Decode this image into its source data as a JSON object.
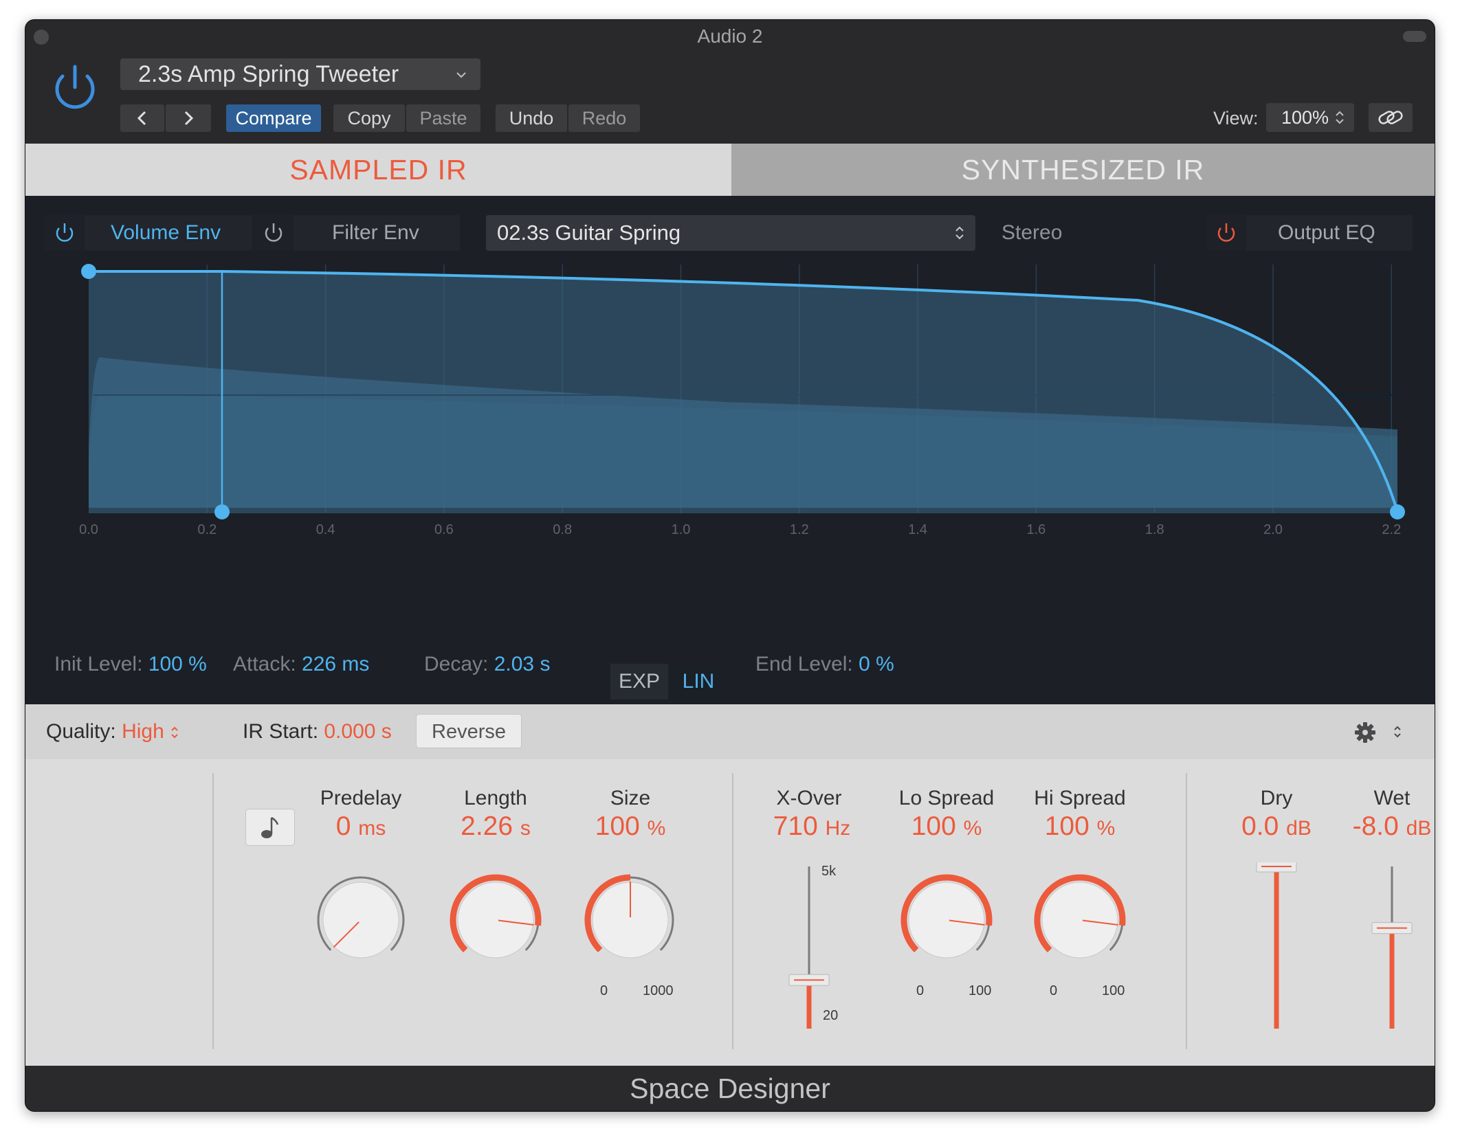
{
  "window": {
    "title": "Audio 2"
  },
  "header": {
    "preset": "2.3s Amp Spring Tweeter",
    "buttons": {
      "compare": "Compare",
      "copy": "Copy",
      "paste": "Paste",
      "undo": "Undo",
      "redo": "Redo"
    },
    "view_label": "View:",
    "view_value": "100%"
  },
  "tabs": {
    "sampled": "SAMPLED IR",
    "synthesized": "SYNTHESIZED IR"
  },
  "env": {
    "volume_env": "Volume Env",
    "filter_env": "Filter Env",
    "ir_name": "02.3s Guitar Spring",
    "stereo": "Stereo",
    "output_eq": "Output EQ"
  },
  "axis_ticks": [
    "0.0",
    "0.2",
    "0.4",
    "0.6",
    "0.8",
    "1.0",
    "1.2",
    "1.4",
    "1.6",
    "1.8",
    "2.0",
    "2.2"
  ],
  "envelope": {
    "init_level_label": "Init Level:",
    "init_level_value": "100 %",
    "attack_label": "Attack:",
    "attack_value": "226 ms",
    "decay_label": "Decay:",
    "decay_value": "2.03 s",
    "exp": "EXP",
    "lin": "LIN",
    "end_level_label": "End Level:",
    "end_level_value": "0 %"
  },
  "quality_bar": {
    "quality_label": "Quality:",
    "quality_value": "High",
    "ir_start_label": "IR Start:",
    "ir_start_value": "0.000 s",
    "reverse": "Reverse"
  },
  "controls": {
    "predelay": {
      "label": "Predelay",
      "value": "0",
      "unit": "ms",
      "level": 0.0
    },
    "length": {
      "label": "Length",
      "value": "2.26",
      "unit": "s",
      "level": 0.86
    },
    "size": {
      "label": "Size",
      "value": "100",
      "unit": "%",
      "level": 0.5,
      "min": "0",
      "max": "1000"
    },
    "xover": {
      "label": "X-Over",
      "value": "710",
      "unit": "Hz",
      "max": "5k",
      "min": "20",
      "level": 0.3
    },
    "lo_spread": {
      "label": "Lo Spread",
      "value": "100",
      "unit": "%",
      "level": 0.86,
      "min": "0",
      "max": "100"
    },
    "hi_spread": {
      "label": "Hi Spread",
      "value": "100",
      "unit": "%",
      "level": 0.86,
      "min": "0",
      "max": "100"
    },
    "dry": {
      "label": "Dry",
      "value": "0.0",
      "unit": "dB",
      "level": 1.0
    },
    "wet": {
      "label": "Wet",
      "value": "-8.0",
      "unit": "dB",
      "level": 0.62
    }
  },
  "footer": {
    "plugin_name": "Space Designer"
  },
  "colors": {
    "accent": "#ec5b3c",
    "blue": "#4fb4ef",
    "compare_bg": "#2d5f96"
  }
}
